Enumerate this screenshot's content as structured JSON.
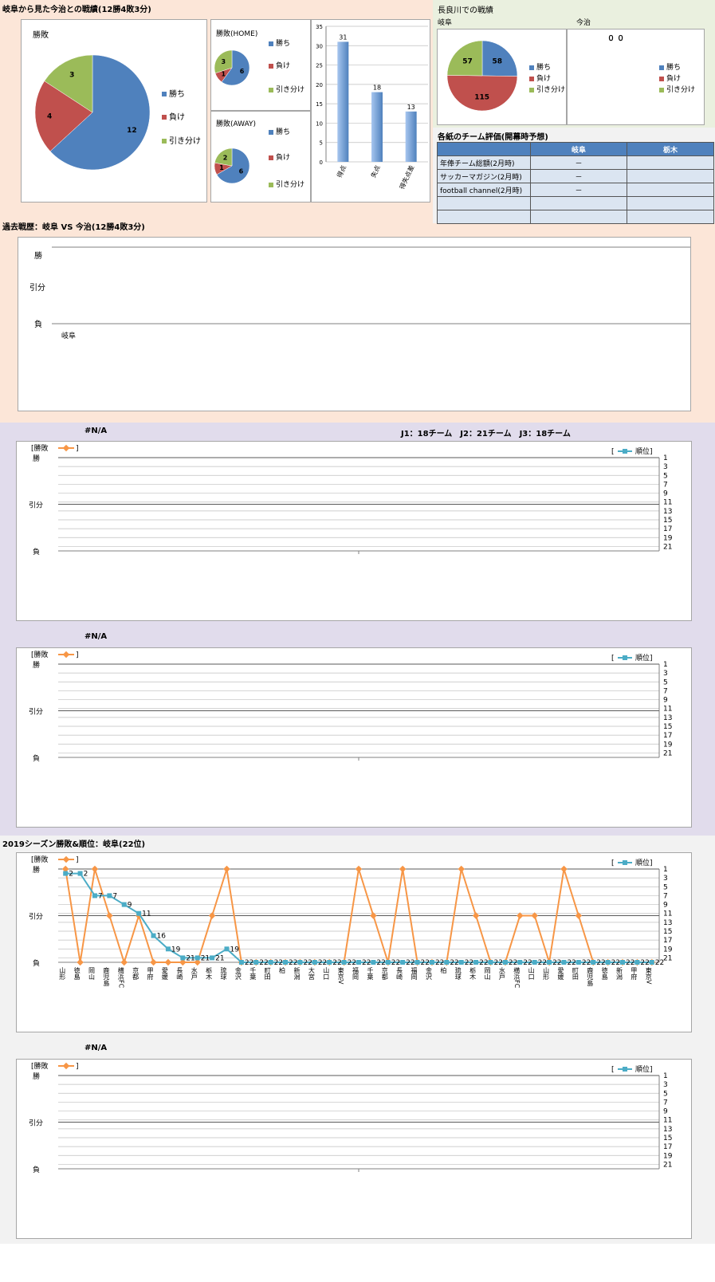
{
  "colors": {
    "win": "#4f81bd",
    "loss": "#c0504d",
    "draw": "#9bbb59",
    "orange": "#f79646",
    "teal": "#4bacc6"
  },
  "section1": {
    "title": "岐阜から見た今治との戦績(12勝4敗3分)",
    "overall": {
      "title": "勝敗",
      "values": {
        "win": 12,
        "loss": 4,
        "draw": 3
      }
    },
    "home": {
      "title": "勝敗(HOME)",
      "values": {
        "win": 6,
        "loss": 1,
        "draw": 3
      }
    },
    "away": {
      "title": "勝敗(AWAY)",
      "values": {
        "win": 6,
        "loss": 1,
        "draw": 2
      }
    },
    "legend": {
      "win": "勝ち",
      "loss": "負け",
      "draw": "引き分け"
    },
    "goals": {
      "categories": [
        "得点",
        "失点",
        "得失点差"
      ],
      "values": [
        31,
        18,
        13
      ],
      "ymax": 35,
      "ticks": [
        "0",
        "5",
        "10",
        "15",
        "20",
        "25",
        "30",
        "35"
      ]
    }
  },
  "nagara": {
    "title": "長良川での戦績",
    "gifu_label": "岐阜",
    "imabari_label": "今治",
    "pie": {
      "win": 58,
      "loss": 115,
      "draw": 57
    },
    "second_label": "０ ０"
  },
  "ratings": {
    "title": "各紙のチーム評価(開幕時予想)",
    "headers": [
      "",
      "岐阜",
      "栃木"
    ],
    "rows": [
      [
        "年俸チーム総額(2月時)",
        "－",
        ""
      ],
      [
        "サッカーマガジン(2月時)",
        "－",
        ""
      ],
      [
        "football channel(2月時)",
        "－",
        ""
      ],
      [
        "",
        "",
        ""
      ],
      [
        "",
        "",
        ""
      ]
    ]
  },
  "history": {
    "title": "過去戦歴：岐阜 VS 今治(12勝4敗3分)",
    "ylabels": [
      "勝",
      "引分",
      "負"
    ],
    "first_tick": "岐阜"
  },
  "band2": {
    "na1": "#N/A",
    "teams_note": "J1：18チーム　J2：21チーム　J3：18チーム",
    "na2": "#N/A"
  },
  "season": {
    "title": "2019シーズン勝敗&順位：岐阜(22位)",
    "na3": "#N/A"
  },
  "chart_common": {
    "left_legend_pre": "[勝敗",
    "left_legend_post": "]",
    "right_legend_pre": "[",
    "right_legend_post": "順位]",
    "ylabels": [
      "勝",
      "引分",
      "負"
    ],
    "right_ticks": [
      "1",
      "3",
      "5",
      "7",
      "9",
      "11",
      "13",
      "15",
      "17",
      "19",
      "21"
    ]
  },
  "chart_data": {
    "type": "line",
    "title": "2019シーズン勝敗&順位：岐阜(22位)",
    "categories": [
      "山形",
      "徳島",
      "岡山",
      "鹿児島",
      "横浜FC",
      "京都",
      "甲府",
      "愛媛",
      "長崎",
      "水戸",
      "栃木",
      "琉球",
      "金沢",
      "千葉",
      "町田",
      "柏",
      "新潟",
      "大宮",
      "山口",
      "東京V",
      "福岡",
      "千葉",
      "京都",
      "長崎",
      "福岡",
      "金沢",
      "柏",
      "琉球",
      "栃木",
      "岡山",
      "水戸",
      "横浜FC",
      "山口",
      "山形",
      "愛媛",
      "町田",
      "鹿児島",
      "徳島",
      "新潟",
      "甲府",
      "東京V"
    ],
    "series": [
      {
        "name": "勝敗",
        "axis": "left",
        "values": [
          1,
          -1,
          1,
          0,
          -1,
          0,
          -1,
          -1,
          -1,
          -1,
          0,
          1,
          -1,
          -1,
          -1,
          -1,
          -1,
          -1,
          -1,
          -1,
          1,
          0,
          -1,
          1,
          -1,
          -1,
          -1,
          1,
          0,
          -1,
          -1,
          0,
          0,
          -1,
          1,
          0,
          -1,
          -1,
          -1,
          -1,
          -1
        ]
      },
      {
        "name": "順位",
        "axis": "right",
        "values": [
          2,
          2,
          7,
          7,
          9,
          11,
          16,
          19,
          21,
          21,
          21,
          19,
          22,
          22,
          22,
          22,
          22,
          22,
          22,
          22,
          22,
          22,
          22,
          22,
          22,
          22,
          22,
          22,
          22,
          22,
          22,
          22,
          22,
          22,
          22,
          22,
          22,
          22,
          22,
          22,
          22
        ]
      }
    ]
  }
}
